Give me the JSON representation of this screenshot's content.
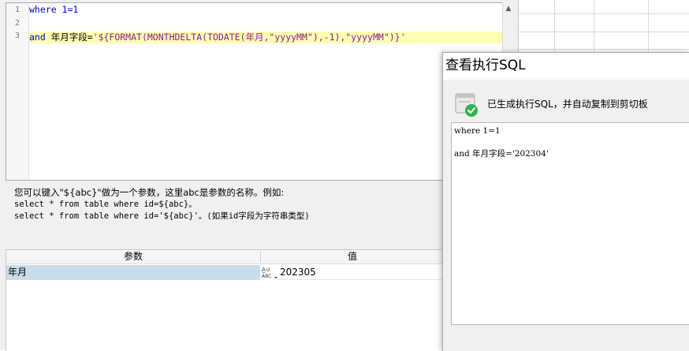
{
  "editor": {
    "line_numbers": [
      "1",
      "2",
      "3"
    ],
    "line1": {
      "kw": "where",
      "rest": " 1=1"
    },
    "line3": {
      "kw": "and",
      "text": " 年月字段=",
      "expr": "'${FORMAT(MONTHDELTA(TODATE(年月,\"yyyyMM\"),-1),\"yyyyMM\")}'"
    }
  },
  "hint": {
    "line1": "您可以键入\"${abc}\"做为一个参数，这里abc是参数的名称。例如:",
    "line2": "select * from table where id=${abc}。",
    "line3": "select * from table where id='${abc}'。(如果id字段为字符串类型)"
  },
  "params": {
    "header_param": "参数",
    "header_value": "值",
    "rows": [
      {
        "name": "年月",
        "type_icon": "abc-type-icon",
        "value": "202305"
      }
    ]
  },
  "popup": {
    "title": "查看执行SQL",
    "status": "已生成执行SQL，并自动复制到剪切板",
    "status_icon": "success-check-icon",
    "sql_lines": [
      "where 1=1",
      "",
      "and 年月字段='202304'"
    ]
  },
  "colors": {
    "keyword": "#0000cc",
    "string": "#8c1a99",
    "current_line": "#ffffb3",
    "selected_row": "#c9dcea",
    "success": "#2fb34a"
  }
}
